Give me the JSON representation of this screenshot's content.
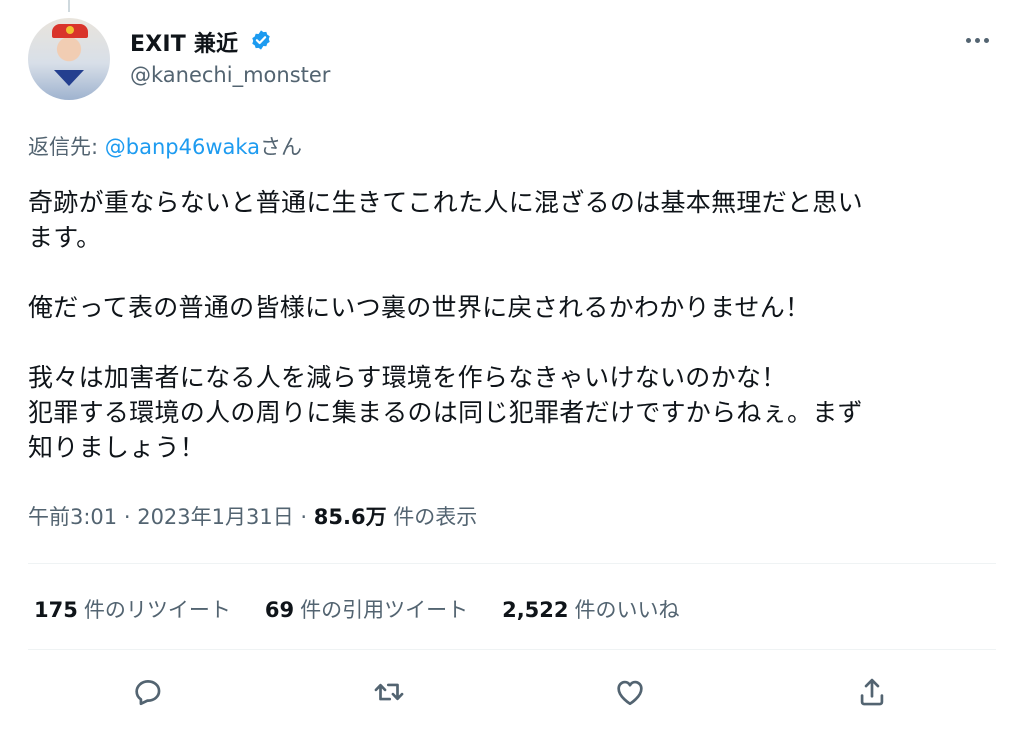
{
  "author": {
    "display_name": "EXIT 兼近",
    "handle": "@kanechi_monster",
    "verified": true
  },
  "reply": {
    "prefix": "返信先: ",
    "mention": "@banp46waka",
    "suffix": "さん"
  },
  "tweet": {
    "text": "奇跡が重ならないと普通に生きてこれた人に混ざるのは基本無理だと思い\nます。\n\n俺だって表の普通の皆様にいつ裏の世界に戻されるかわかりません！\n\n我々は加害者になる人を減らす環境を作らなきゃいけないのかな！\n犯罪する環境の人の周りに集まるのは同じ犯罪者だけですからねぇ。まず\n知りましょう！"
  },
  "meta": {
    "time": "午前3:01",
    "separator": " · ",
    "date": "2023年1月31日",
    "views_count": "85.6万",
    "views_label": " 件の表示"
  },
  "stats": {
    "retweets_count": "175",
    "retweets_label": "件のリツイート",
    "quotes_count": "69",
    "quotes_label": "件の引用ツイート",
    "likes_count": "2,522",
    "likes_label": "件のいいね"
  },
  "icons": {
    "verified": "verified-badge-icon",
    "more": "more-icon",
    "reply": "reply-icon",
    "retweet": "retweet-icon",
    "like": "like-icon",
    "share": "share-icon"
  },
  "colors": {
    "accent": "#1d9bf0",
    "secondary_text": "#536471",
    "primary_text": "#0f1419"
  }
}
